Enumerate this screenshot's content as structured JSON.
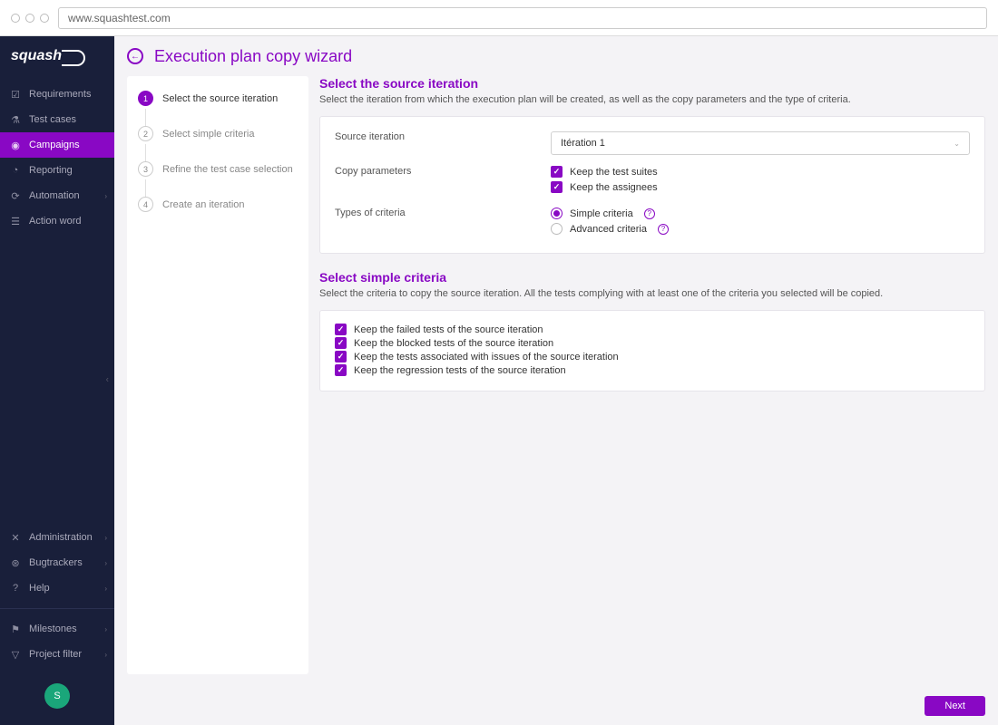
{
  "browser": {
    "url": "www.squashtest.com"
  },
  "logo": "squash",
  "sidebar": {
    "main": [
      {
        "label": "Requirements",
        "icon": "check-square"
      },
      {
        "label": "Test cases",
        "icon": "flask"
      },
      {
        "label": "Campaigns",
        "icon": "play-circle",
        "active": true
      },
      {
        "label": "Reporting",
        "icon": "gauge"
      },
      {
        "label": "Automation",
        "icon": "refresh",
        "expandable": true
      },
      {
        "label": "Action word",
        "icon": "list"
      }
    ],
    "secondary": [
      {
        "label": "Administration",
        "icon": "tools",
        "expandable": true
      },
      {
        "label": "Bugtrackers",
        "icon": "bug",
        "expandable": true
      },
      {
        "label": "Help",
        "icon": "help",
        "expandable": true
      }
    ],
    "tertiary": [
      {
        "label": "Milestones",
        "icon": "flag",
        "expandable": true
      },
      {
        "label": "Project filter",
        "icon": "filter",
        "expandable": true
      }
    ],
    "avatar": "S"
  },
  "header": {
    "title": "Execution plan copy wizard"
  },
  "steps": [
    {
      "num": "1",
      "label": "Select the source iteration",
      "active": true
    },
    {
      "num": "2",
      "label": "Select simple criteria"
    },
    {
      "num": "3",
      "label": "Refine the test case selection"
    },
    {
      "num": "4",
      "label": "Create an iteration"
    }
  ],
  "section1": {
    "title": "Select the source iteration",
    "desc": "Select the iteration from which the execution plan will be created, as well as the copy parameters and the type of criteria.",
    "labels": {
      "source": "Source iteration",
      "copy": "Copy parameters",
      "types": "Types of criteria"
    },
    "source_value": "Itération 1",
    "copy_opts": [
      {
        "label": "Keep the test suites",
        "checked": true
      },
      {
        "label": "Keep the assignees",
        "checked": true
      }
    ],
    "type_opts": [
      {
        "label": "Simple criteria",
        "checked": true
      },
      {
        "label": "Advanced criteria",
        "checked": false
      }
    ]
  },
  "section2": {
    "title": "Select simple criteria",
    "desc": "Select the criteria to copy the source iteration. All the tests complying with at least one of the criteria you selected will be copied.",
    "criteria": [
      {
        "label": "Keep the failed tests of the source iteration",
        "checked": true
      },
      {
        "label": "Keep the blocked tests of the source iteration",
        "checked": true
      },
      {
        "label": "Keep the tests associated with issues of the source iteration",
        "checked": true
      },
      {
        "label": "Keep the regression tests of the source iteration",
        "checked": true
      }
    ]
  },
  "footer": {
    "next": "Next"
  }
}
